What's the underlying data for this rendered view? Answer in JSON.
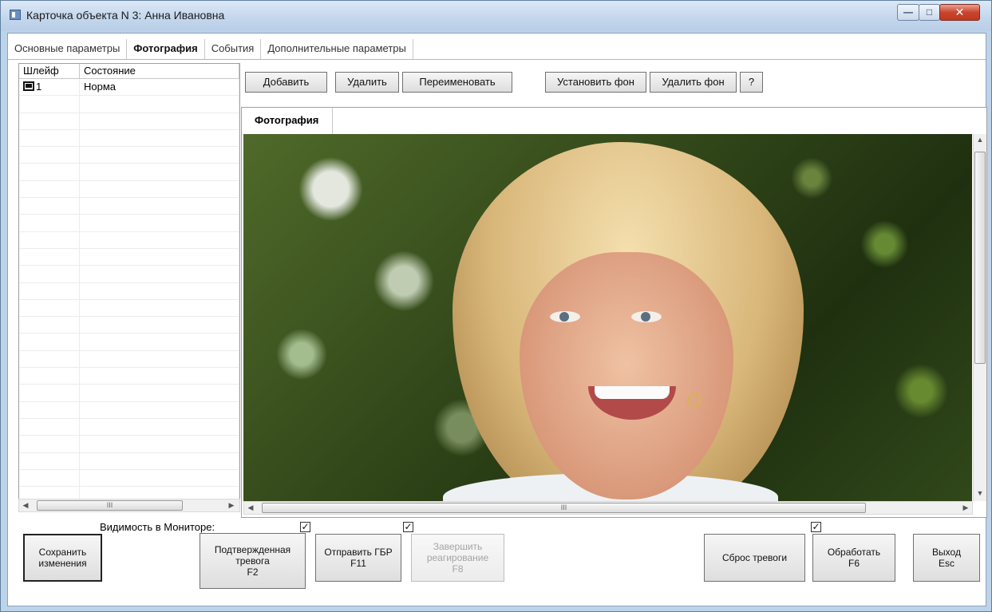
{
  "window": {
    "title": "Карточка объекта N 3: Анна Ивановна",
    "min_glyph": "—",
    "max_glyph": "□",
    "close_glyph": "✕"
  },
  "tabs": [
    {
      "label": "Основные параметры",
      "active": false
    },
    {
      "label": "Фотография",
      "active": true
    },
    {
      "label": "События",
      "active": false
    },
    {
      "label": "Дополнительные параметры",
      "active": false
    }
  ],
  "list": {
    "columns": [
      "Шлейф",
      "Состояние"
    ],
    "rows": [
      {
        "loop": "1",
        "state": "Норма",
        "icon": "monitor-icon"
      }
    ],
    "scroll_grip": "III"
  },
  "toolbar": {
    "add": "Добавить",
    "delete": "Удалить",
    "rename": "Переименовать",
    "set_bg": "Установить фон",
    "delete_bg": "Удалить фон",
    "help": "?"
  },
  "photo_panel": {
    "tab_label": "Фотография",
    "scroll_grip": "III"
  },
  "bottom": {
    "visibility_label": "Видимость в Мониторе:",
    "save": "Сохранить\nизменения",
    "confirmed_alarm": "Подтвержденная\nтревога\nF2",
    "send_gbr": "Отправить ГБР\nF11",
    "finish_response": "Завершить\nреагирование\nF8",
    "reset_alarm": "Сброс тревоги",
    "process": "Обработать\nF6",
    "exit": "Выход\nEsc",
    "checkbox_mark": "✓",
    "checkboxes": {
      "confirmed": true,
      "send_gbr": true,
      "process": true
    }
  }
}
